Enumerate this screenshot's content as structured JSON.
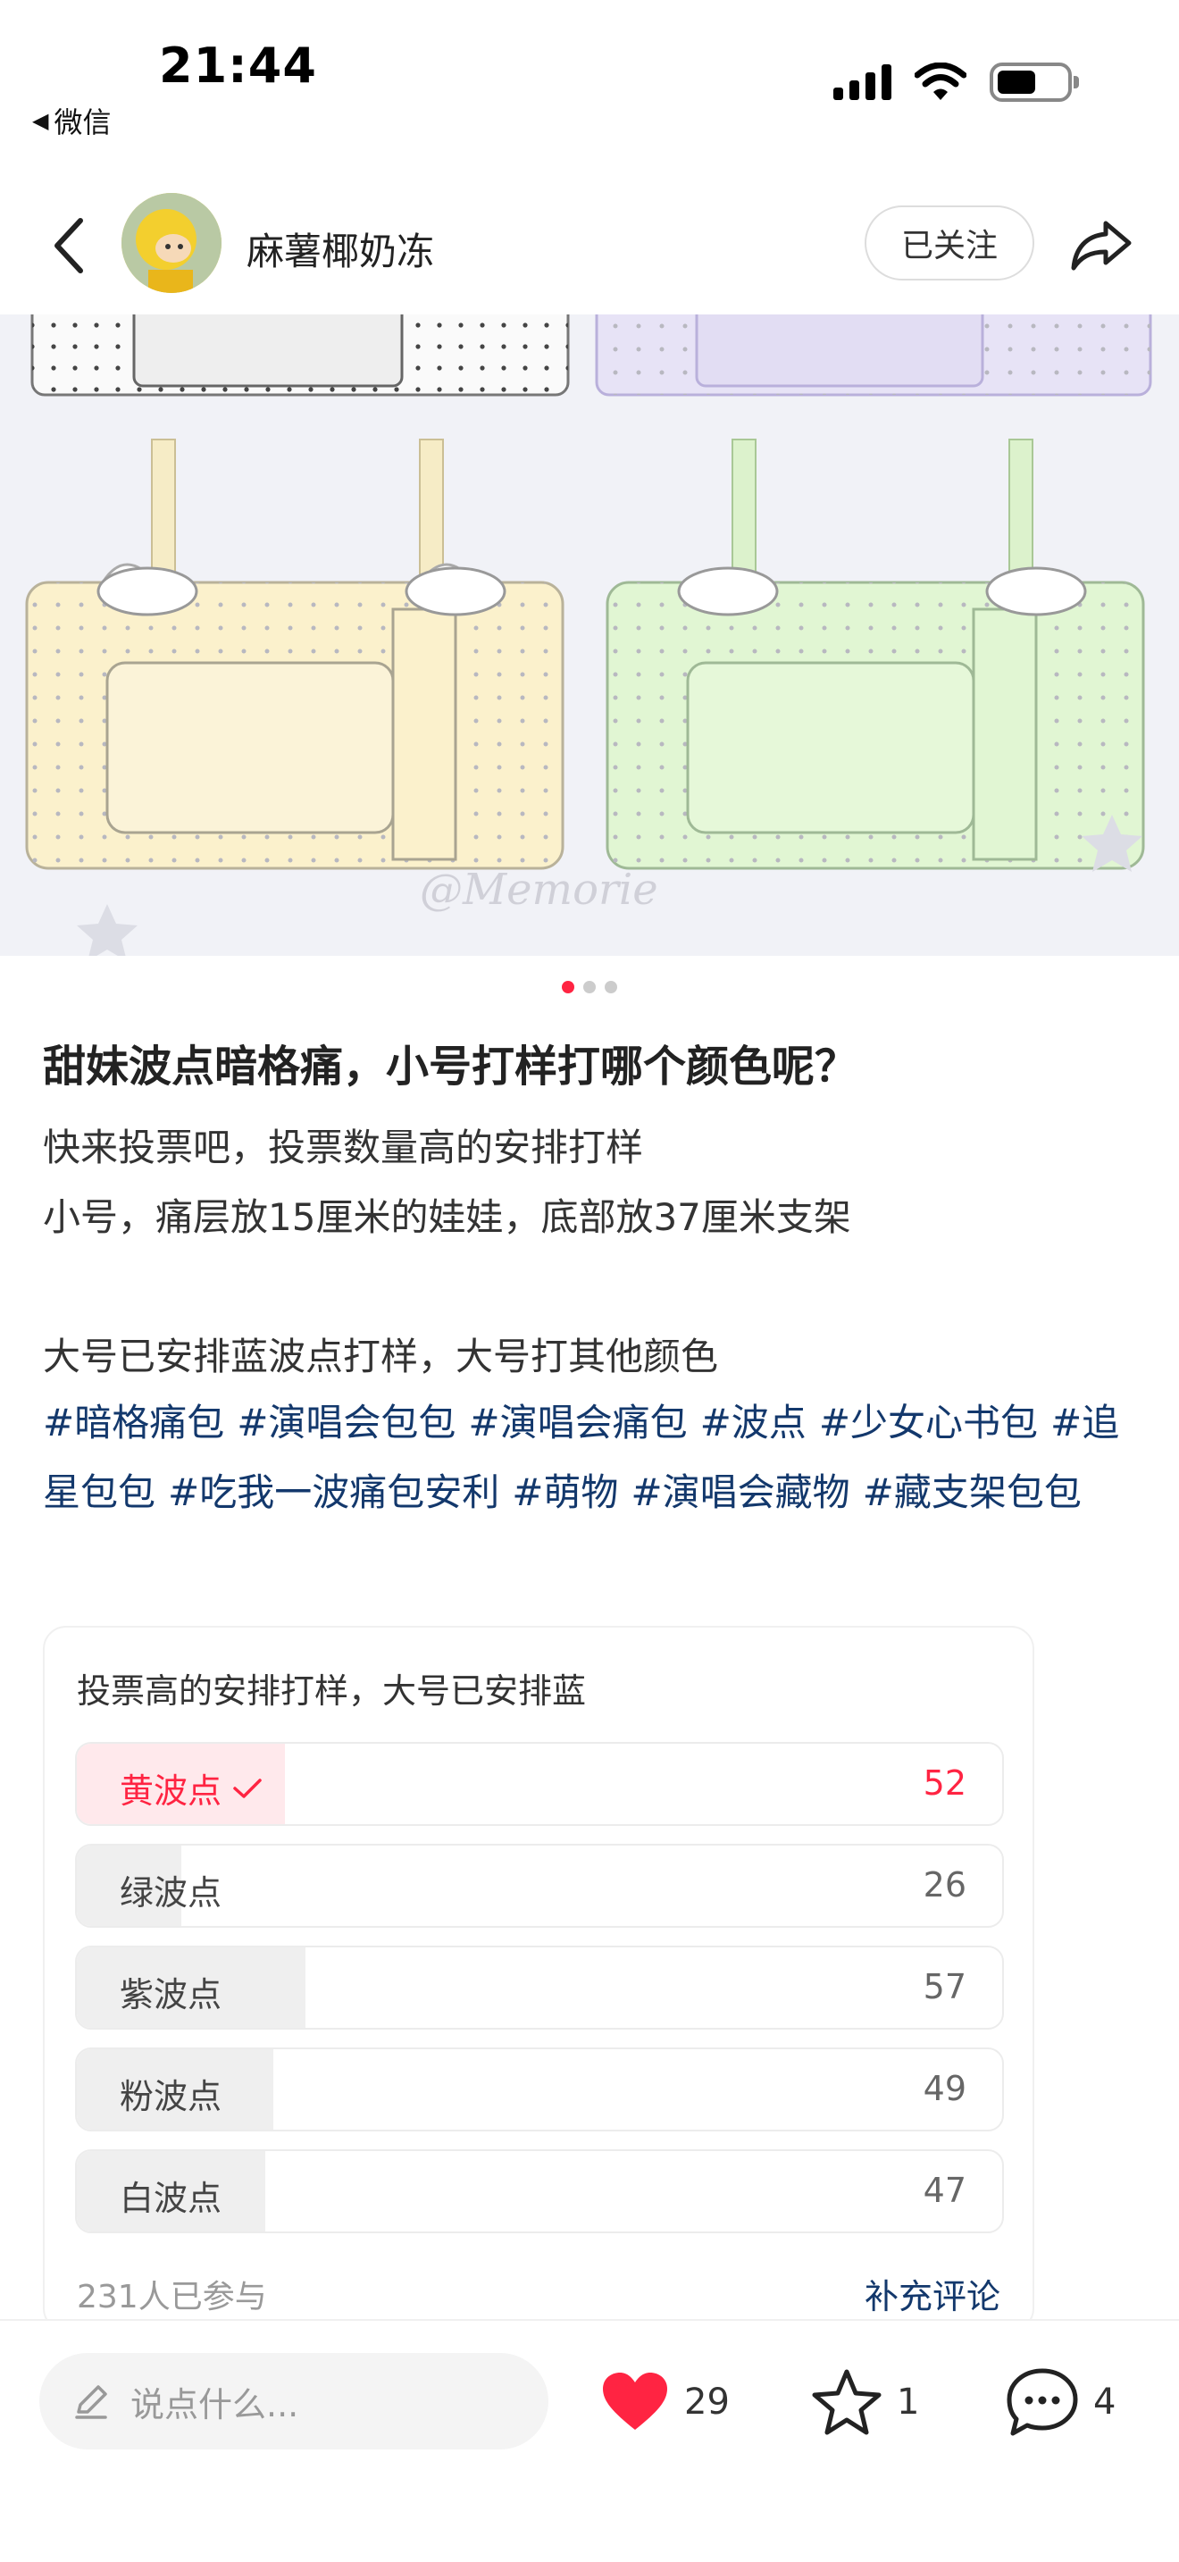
{
  "status_bar": {
    "time": "21:44",
    "back_app": "微信"
  },
  "header": {
    "author": "麻薯椰奶冻",
    "follow_label": "已关注"
  },
  "image_carousel": {
    "count": 3,
    "active_index": 0,
    "watermark": "@Memorie"
  },
  "post": {
    "title": "甜妹波点暗格痛，小号打样打哪个颜色呢？",
    "body_lines": [
      "快来投票吧，投票数量高的安排打样",
      "小号，痛层放15厘米的娃娃，底部放37厘米支架",
      "",
      "大号已安排蓝波点打样，大号打其他颜色"
    ],
    "tags": [
      "#暗格痛包",
      "#演唱会包包",
      "#演唱会痛包",
      "#波点",
      "#少女心书包",
      "#追星包包",
      "#吃我一波痛包安利",
      "#萌物",
      "#演唱会藏物",
      "#藏支架包包"
    ]
  },
  "poll": {
    "question": "投票高的安排打样，大号已安排蓝",
    "options": [
      {
        "label": "黄波点",
        "count": "52",
        "selected": true
      },
      {
        "label": "绿波点",
        "count": "26",
        "selected": false
      },
      {
        "label": "紫波点",
        "count": "57",
        "selected": false
      },
      {
        "label": "粉波点",
        "count": "49",
        "selected": false
      },
      {
        "label": "白波点",
        "count": "47",
        "selected": false
      }
    ],
    "participants": "231人已参与",
    "comment_link": "补充评论"
  },
  "bottom_bar": {
    "input_placeholder": "说点什么...",
    "likes": "29",
    "favorites": "1",
    "comments": "4"
  },
  "colors": {
    "accent": "#ff2442",
    "tag_link": "#13386c",
    "poll_bar": "#efefef",
    "poll_selected_bar": "#ffe9ec"
  }
}
